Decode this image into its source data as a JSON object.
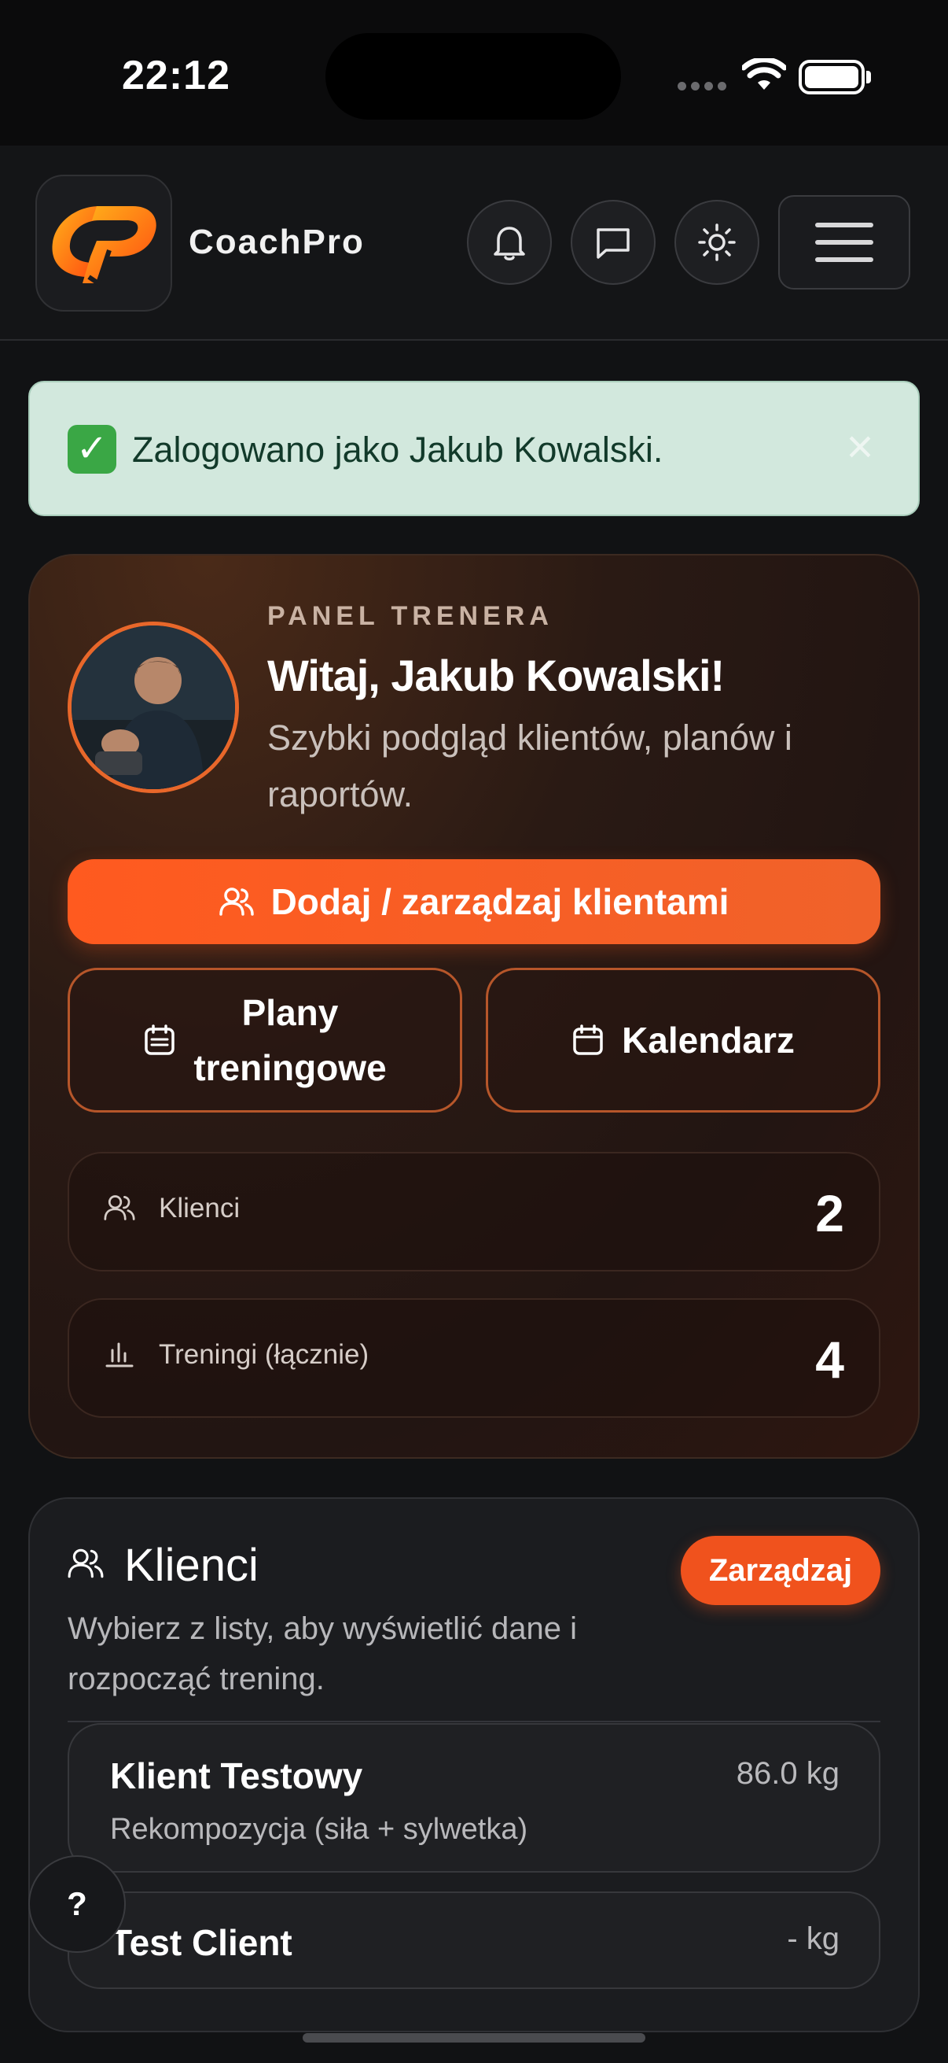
{
  "status_bar": {
    "time": "22:12"
  },
  "header": {
    "brand": "CoachPro",
    "icons": [
      "bell-icon",
      "chat-icon",
      "sun-icon",
      "hamburger-menu-icon"
    ]
  },
  "alert": {
    "text": "Zalogowano jako Jakub Kowalski.",
    "close": "×"
  },
  "panel": {
    "eyebrow": "PANEL TRENERA",
    "title": "Witaj, Jakub Kowalski!",
    "subtitle": "Szybki podgląd klientów, planów i raportów.",
    "cta_label": "Dodaj / zarządzaj klientami",
    "plans_label_line1": "Plany",
    "plans_label_line2": "treningowe",
    "calendar_label": "Kalendarz",
    "stats": [
      {
        "label": "Klienci",
        "value": "2"
      },
      {
        "label": "Treningi (łącznie)",
        "value": "4"
      }
    ]
  },
  "clients": {
    "title": "Klienci",
    "subtitle": "Wybierz z listy, aby wyświetlić dane i rozpocząć trening.",
    "manage_label": "Zarządzaj",
    "items": [
      {
        "name": "Klient Testowy",
        "goal": "Rekompozycja (siła + sylwetka)",
        "weight": "86.0 kg"
      },
      {
        "name": "Test Client",
        "goal": "",
        "weight": "- kg"
      }
    ]
  },
  "help": {
    "label": "?"
  },
  "colors": {
    "accent": "#f0521d",
    "alert_bg": "#d2e8dd",
    "background": "#111214"
  }
}
